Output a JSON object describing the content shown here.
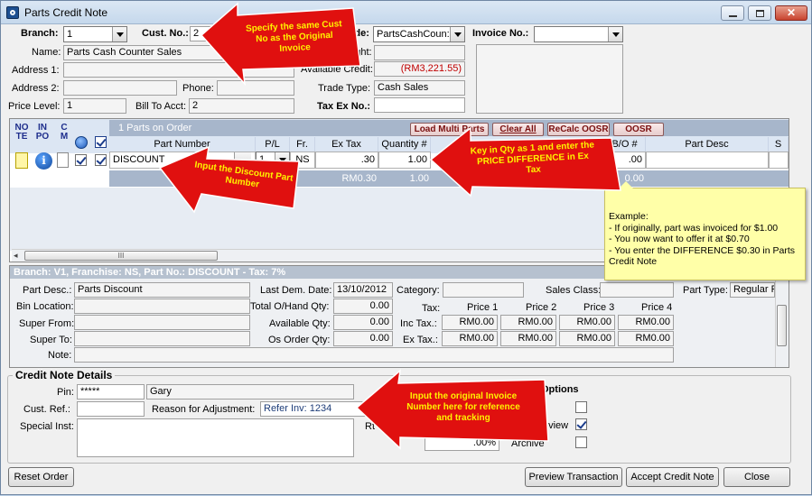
{
  "window": {
    "title": "Parts Credit Note"
  },
  "header": {
    "branch_label": "Branch:",
    "branch_value": "1",
    "custno_label": "Cust. No.:",
    "custno_value": "2",
    "acct_code_label": "t Code:",
    "acct_code_value": "PartsCashCoun:",
    "invoice_label": "Invoice No.:",
    "name_label": "Name:",
    "name_value": "Parts Cash Counter Sales",
    "freight_label": "reight:",
    "address1_label": "Address 1:",
    "available_credit_label": "Available Credit:",
    "available_credit_value": "(RM3,221.55)",
    "address2_label": "Address 2:",
    "phone_label": "Phone:",
    "trade_type_label": "Trade Type:",
    "trade_type_value": "Cash Sales",
    "price_level_label": "Price Level:",
    "price_level_value": "1",
    "bill_to_label": "Bill To Acct:",
    "bill_to_value": "2",
    "tax_ex_label": "Tax Ex No.:"
  },
  "grid": {
    "icon_headers": [
      "NO\nTE",
      "IN\nPO",
      "C\nM"
    ],
    "parts_on_order": "1 Parts on Order",
    "buttons": {
      "load_multi": "Load Multi Parts",
      "clear_all": "Clear All",
      "recalc": "ReCalc OOSR",
      "oosr": "OOSR"
    },
    "columns": [
      "Part Number",
      "P/L",
      "Fr.",
      "Ex Tax",
      "Quantity #",
      "B/O #",
      "Part Desc",
      "S"
    ],
    "row": {
      "part_number": "DISCOUNT",
      "pl": "1",
      "fr": "NS",
      "ex_tax": ".30",
      "quantity": "1.00",
      "bo": ".00"
    },
    "total_row": {
      "ex_tax": "RM0.30",
      "quantity": "1.00",
      "bo": "0.00"
    },
    "scroll_grip": "III"
  },
  "detail": {
    "title": "Branch: V1, Franchise: NS, Part No.: DISCOUNT  -  Tax: 7%",
    "part_desc_label": "Part Desc.:",
    "part_desc_value": "Parts Discount",
    "last_dem_label": "Last Dem. Date:",
    "last_dem_value": "13/10/2012",
    "category_label": "Category:",
    "sales_class_label": "Sales Class:",
    "part_type_label": "Part Type:",
    "part_type_value": "Regular P",
    "bin_location_label": "Bin Location:",
    "total_onhand_label": "Total O/Hand Qty:",
    "total_onhand_value": "0.00",
    "tax_label": "Tax:",
    "price_headers": [
      "Price 1",
      "Price 2",
      "Price 3",
      "Price 4"
    ],
    "super_from_label": "Super From:",
    "available_qty_label": "Available Qty:",
    "available_qty_value": "0.00",
    "inc_tax_label": "Inc Tax.:",
    "inc_tax_values": [
      "RM0.00",
      "RM0.00",
      "RM0.00",
      "RM0.00"
    ],
    "super_to_label": "Super To:",
    "os_order_label": "Os Order Qty:",
    "os_order_value": "0.00",
    "ex_tax_label": "Ex Tax.:",
    "ex_tax_values": [
      "RM0.00",
      "RM0.00",
      "RM0.00",
      "RM0.00"
    ],
    "note_label": "Note:"
  },
  "credit": {
    "section_title": "Credit Note Details",
    "pin_label": "Pin:",
    "pin_value": "*****",
    "pin_name": "Gary",
    "cust_ref_label": "Cust. Ref.:",
    "reason_label": "Reason for Adjustment:",
    "reason_value": "Refer Inv: 1234",
    "special_inst_label": "Special Inst:",
    "rt_label": "Rt",
    "options_title": "Options",
    "review_label": "eview",
    "archive_label": "Archive",
    "percent_value": ".00%"
  },
  "footer": {
    "reset_order": "Reset Order",
    "preview": "Preview Transaction",
    "accept": "Accept Credit Note",
    "close": "Close"
  },
  "tooltip": {
    "lines": [
      "Example:",
      "- If originally, part was invoiced for $1.00",
      "- You now want to offer it at $0.70",
      "- You enter the DIFFERENCE $0.30 in Parts Credit Note"
    ]
  },
  "callouts": {
    "custno": "Specify the same Cust No as the Original Invoice",
    "qty": "Key in Qty as 1 and enter the PRICE DIFFERENCE in Ex Tax",
    "discount": "Input the Discount Part Number",
    "invoice": "Input the original Invoice Number here for reference and tracking"
  },
  "colors": {
    "arrow_red": "#e0100f",
    "callout_text": "#fff200",
    "tooltip_bg": "#ffffa8",
    "credit_red": "#c00000"
  }
}
